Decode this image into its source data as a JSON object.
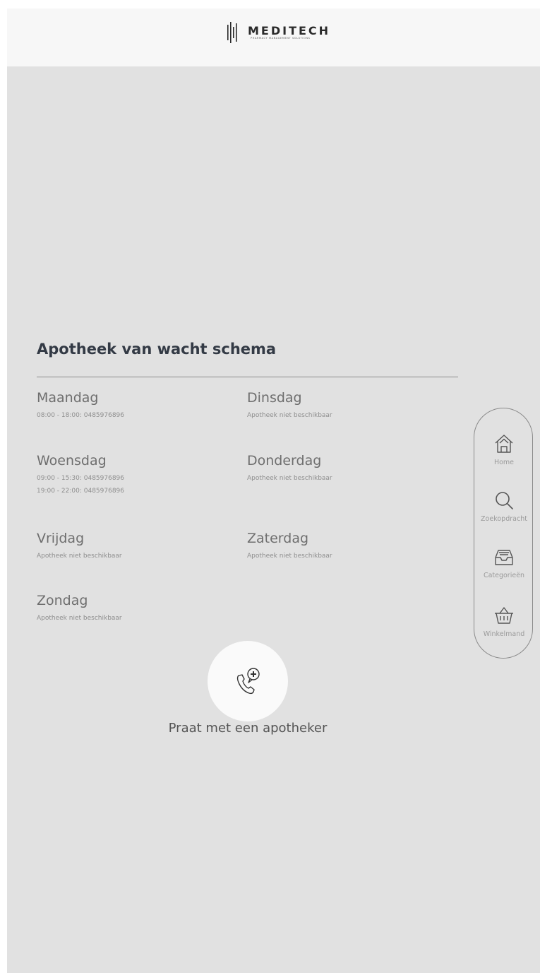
{
  "brand": {
    "name": "MEDITECH",
    "tagline": "PHARMACY MANAGEMENT SOLUTIONS"
  },
  "schedule": {
    "title": "Apotheek van wacht schema",
    "days": {
      "maandag": {
        "name": "Maandag",
        "lines": [
          "08:00 - 18:00: 0485976896"
        ]
      },
      "dinsdag": {
        "name": "Dinsdag",
        "lines": [
          "Apotheek niet beschikbaar"
        ]
      },
      "woensdag": {
        "name": "Woensdag",
        "lines": [
          "09:00 - 15:30: 0485976896",
          "19:00 - 22:00: 0485976896"
        ]
      },
      "donderdag": {
        "name": "Donderdag",
        "lines": [
          "Apotheek niet beschikbaar"
        ]
      },
      "vrijdag": {
        "name": "Vrijdag",
        "lines": [
          "Apotheek niet beschikbaar"
        ]
      },
      "zaterdag": {
        "name": "Zaterdag",
        "lines": [
          "Apotheek niet beschikbaar"
        ]
      },
      "zondag": {
        "name": "Zondag",
        "lines": [
          "Apotheek niet beschikbaar"
        ]
      }
    }
  },
  "nav": {
    "home": "Home",
    "search": "Zoekopdracht",
    "categories": "Categorieën",
    "cart": "Winkelmand"
  },
  "chat": {
    "label": "Praat met een apotheker",
    "icon": "phone-plus-icon"
  },
  "colors": {
    "background": "#e1e1e1",
    "header": "#f7f7f7",
    "title": "#333a45"
  }
}
